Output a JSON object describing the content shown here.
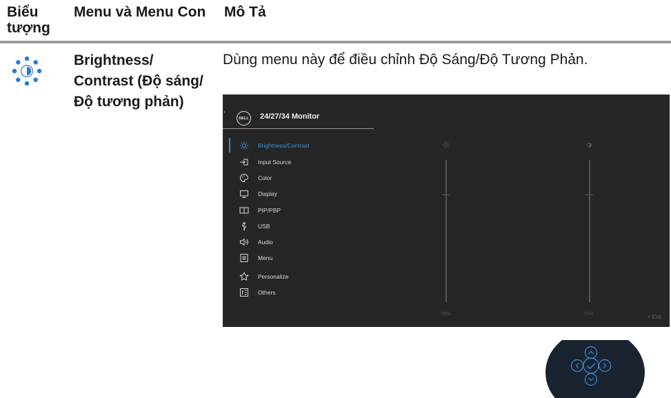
{
  "header": {
    "col_icon": "Biểu tượng",
    "col_menu": "Menu và Menu Con",
    "col_desc": "Mô Tả"
  },
  "row": {
    "icon": "brightness-contrast-icon",
    "menu_name": "Brightness/ Contrast (Độ sáng/Độ tương phản)",
    "description": "Dùng menu này để điều chỉnh Độ Sáng/Độ Tương Phản."
  },
  "osd": {
    "corner_mark": ".",
    "logo_text": "DELL",
    "title": "24/27/34 Monitor",
    "menu_items": [
      {
        "label": "Brightness/Contrast",
        "icon": "brightness-icon",
        "selected": true
      },
      {
        "label": "Input Source",
        "icon": "input-source-icon",
        "selected": false
      },
      {
        "label": "Color",
        "icon": "color-palette-icon",
        "selected": false
      },
      {
        "label": "Display",
        "icon": "display-icon",
        "selected": false
      },
      {
        "label": "PIP/PBP",
        "icon": "pip-pbp-icon",
        "selected": false
      },
      {
        "label": "USB",
        "icon": "usb-icon",
        "selected": false
      },
      {
        "label": "Audio",
        "icon": "audio-icon",
        "selected": false
      },
      {
        "label": "Menu",
        "icon": "menu-icon",
        "selected": false
      },
      {
        "label": "Personalize",
        "icon": "star-icon",
        "selected": false
      },
      {
        "label": "Others",
        "icon": "others-icon",
        "selected": false
      }
    ],
    "brightness_value": "75%",
    "contrast_value": "75%",
    "exit_label": "< Exit",
    "accent_color": "#3a8ede"
  },
  "joystick": {
    "buttons": [
      "up-arrow-icon",
      "left-arrow-icon",
      "check-icon",
      "right-arrow-icon",
      "down-arrow-icon"
    ]
  }
}
